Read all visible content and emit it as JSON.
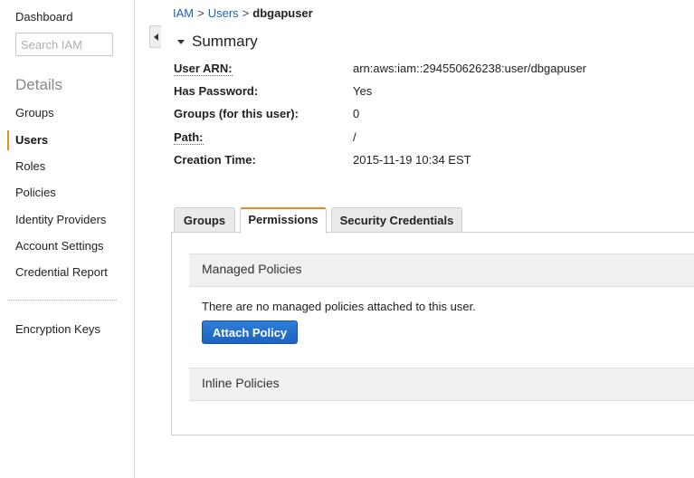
{
  "sidebar": {
    "dashboard": "Dashboard",
    "search_placeholder": "Search IAM",
    "details_heading": "Details",
    "items": [
      {
        "label": "Groups"
      },
      {
        "label": "Users"
      },
      {
        "label": "Roles"
      },
      {
        "label": "Policies"
      },
      {
        "label": "Identity Providers"
      },
      {
        "label": "Account Settings"
      },
      {
        "label": "Credential Report"
      }
    ],
    "encryption": "Encryption Keys",
    "active_item": "Users",
    "accent_color": "#e88b1a"
  },
  "breadcrumb": {
    "root": "IAM",
    "separator": ">",
    "users": "Users",
    "current": "dbgapuser"
  },
  "summary": {
    "title": "Summary",
    "fields": [
      {
        "label": "User ARN:",
        "value": "arn:aws:iam::294550626238:user/dbgapuser"
      },
      {
        "label": "Has Password:",
        "value": "Yes"
      },
      {
        "label": "Groups (for this user):",
        "value": "0"
      },
      {
        "label": "Path:",
        "value": "/"
      },
      {
        "label": "Creation Time:",
        "value": "2015-11-19 10:34 EST"
      }
    ]
  },
  "tabs": [
    {
      "label": "Groups"
    },
    {
      "label": "Permissions"
    },
    {
      "label": "Security Credentials"
    }
  ],
  "active_tab": "Permissions",
  "permissions": {
    "managed_title": "Managed Policies",
    "no_policies_text": "There are no managed policies attached to this user.",
    "attach_button": "Attach Policy",
    "inline_title": "Inline Policies",
    "button_color": "#1e62c0"
  }
}
